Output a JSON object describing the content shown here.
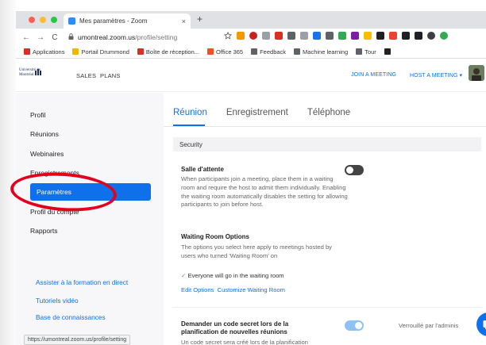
{
  "browser": {
    "tab_title": "Mes paramètres - Zoom",
    "tab_close": "×",
    "new_tab": "+",
    "back": "←",
    "forward": "→",
    "reload": "C",
    "lock": "🔒",
    "url_host": "umontreal.zoom.us",
    "url_path": "/profile/setting",
    "status_url": "https://umontreal.zoom.us/profile/setting"
  },
  "bookmarks": [
    {
      "label": "Applications",
      "color": "#d93025"
    },
    {
      "label": "Portail Drummond",
      "color": "#f4b400"
    },
    {
      "label": "Boîte de réception...",
      "color": "#d93025"
    },
    {
      "label": "Office 365",
      "color": "#f25022"
    },
    {
      "label": "Feedback",
      "color": "#5f6368"
    },
    {
      "label": "Machine learning",
      "color": "#5f6368"
    },
    {
      "label": "Tour",
      "color": "#5f6368"
    }
  ],
  "header": {
    "logo_text": "Université de Montréal",
    "nav": [
      "SALES",
      "PLANS"
    ],
    "join_meeting": "JOIN A MEETING",
    "host_meeting": "HOST A MEETING ▾"
  },
  "sidebar": {
    "items": [
      "Profil",
      "Réunions",
      "Webinaires",
      "Enregistrements",
      "Paramètres",
      "Profil du compte",
      "Rapports"
    ],
    "active_index": 4,
    "links": [
      "Assister à la formation en direct",
      "Tutoriels vidéo",
      "Base de connaissances"
    ]
  },
  "main": {
    "tabs": [
      "Réunion",
      "Enregistrement",
      "Téléphone"
    ],
    "active_tab": 0,
    "section": "Security",
    "waiting_room": {
      "title": "Salle d'attente",
      "description": "When participants join a meeting, place them in a waiting room and require the host to admit them individually. Enabling the waiting room automatically disables the setting for allowing participants to join before host.",
      "enabled": false
    },
    "waiting_options": {
      "title": "Waiting Room Options",
      "description": "The options you select here apply to meetings hosted by users who turned 'Waiting Room' on",
      "check_mark": "✓",
      "selected_option": "Everyone will go in the waiting room",
      "edit_options": "Edit Options",
      "customize": "Customize Waiting Room"
    },
    "passcode": {
      "title": "Demander un code secret lors de la planification de nouvelles réunions",
      "description": "Un code secret sera créé lors de la planification",
      "enabled": true,
      "locked_label": "Verrouillé par l'adminis"
    }
  },
  "colors": {
    "accent": "#0e71eb",
    "annotation": "#e3001b",
    "toggle_off": "#444444",
    "toggle_on": "#8fc1f5"
  }
}
